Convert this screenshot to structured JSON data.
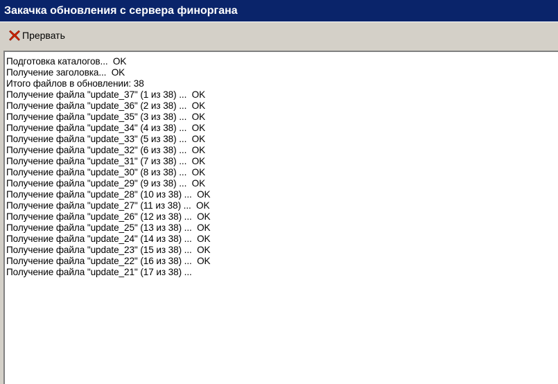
{
  "window": {
    "title": "Закачка обновления с сервера финоргана"
  },
  "toolbar": {
    "abort_label": "Прервать",
    "abort_icon": "red-x-icon"
  },
  "log": {
    "lines": [
      "Подготовка каталогов...  OK",
      "Получение заголовка...  OK",
      "Итого файлов в обновлении: 38",
      "Получение файла \"update_37\" (1 из 38) ...  OK",
      "Получение файла \"update_36\" (2 из 38) ...  OK",
      "Получение файла \"update_35\" (3 из 38) ...  OK",
      "Получение файла \"update_34\" (4 из 38) ...  OK",
      "Получение файла \"update_33\" (5 из 38) ...  OK",
      "Получение файла \"update_32\" (6 из 38) ...  OK",
      "Получение файла \"update_31\" (7 из 38) ...  OK",
      "Получение файла \"update_30\" (8 из 38) ...  OK",
      "Получение файла \"update_29\" (9 из 38) ...  OK",
      "Получение файла \"update_28\" (10 из 38) ...  OK",
      "Получение файла \"update_27\" (11 из 38) ...  OK",
      "Получение файла \"update_26\" (12 из 38) ...  OK",
      "Получение файла \"update_25\" (13 из 38) ...  OK",
      "Получение файла \"update_24\" (14 из 38) ...  OK",
      "Получение файла \"update_23\" (15 из 38) ...  OK",
      "Получение файла \"update_22\" (16 из 38) ...  OK",
      "Получение файла \"update_21\" (17 из 38) ..."
    ]
  },
  "colors": {
    "titlebar_bg": "#0a246a",
    "titlebar_fg": "#ffffff",
    "face": "#d4d0c8",
    "abort_icon": "#cc2200"
  }
}
